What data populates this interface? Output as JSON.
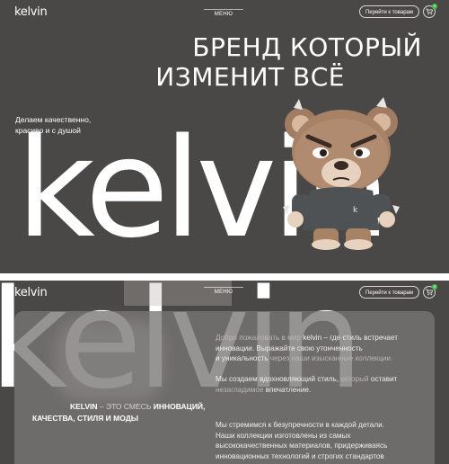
{
  "header": {
    "logo": "kelvin",
    "menu_label": "МЕНЮ",
    "shop_button": "Перейти к товарам",
    "cart_count": "0"
  },
  "hero": {
    "headline_line1": "БРЕНД КОТОРЫЙ",
    "headline_line2": "ИЗМЕНИТ ВСЁ",
    "tagline_line1": "Делаем качественно,",
    "tagline_line2": "красиво и с душой",
    "big_logo": "kelvin",
    "mascot_shirt_letter": "k"
  },
  "about": {
    "kelvin_name": "KELVIN",
    "desc_part1": " – ЭТО СМЕСЬ ",
    "desc_part2": "ИННОВАЦИЙ,",
    "desc_line2": "КАЧЕСТВА, СТИЛЯ И МОДЫ",
    "p1_a": "Добро пожаловать в мир ",
    "p1_brand": "kelvin",
    "p1_b": " – где стиль встречает",
    "p1_l2": "инновации. Выражайте свою утонченность",
    "p1_l3a": "и уникальность ",
    "p1_l3b": "через наши изысканные коллекции.",
    "p2_a": "Мы создаем вдохновляющий стиль, ",
    "p2_b": "который",
    "p2_c": " оставит",
    "p2_l2a": "незагладимое ",
    "p2_l2b": "впечатление.",
    "p3_l1": "Мы стремимся к безупречности в каждой детали.",
    "p3_l2": "Наши коллекции изготовлены из самых",
    "p3_l3": "высококачественных материалов, придерживаясь",
    "p3_l4": "инновационных технологий и строгих стандартов"
  }
}
